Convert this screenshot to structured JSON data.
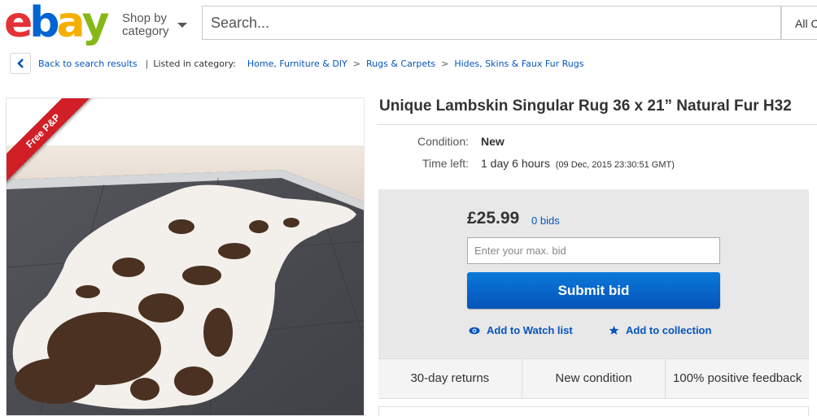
{
  "header": {
    "logo_letters": [
      "e",
      "b",
      "a",
      "y"
    ],
    "shop_by_line1": "Shop by",
    "shop_by_line2": "category",
    "search_placeholder": "Search...",
    "category_select": "All Categories",
    "colors": {
      "logo_e": "#e53238",
      "logo_b": "#0064d2",
      "logo_a": "#f5af02",
      "logo_y": "#86b817"
    }
  },
  "breadcrumb": {
    "back_label": "Back to search results",
    "listed_label": "Listed in category:",
    "items": [
      "Home, Furniture & DIY",
      "Rugs & Carpets",
      "Hides, Skins & Faux Fur Rugs"
    ],
    "back_icon": "chevron-left-icon"
  },
  "listing": {
    "ribbon": "Free P&P",
    "title": "Unique Lambskin Singular Rug 36 x 21” Natural Fur H32",
    "condition_label": "Condition:",
    "condition_value": "New",
    "time_left_label": "Time left:",
    "time_left_value": "1 day 6 hours",
    "time_left_date": "(09 Dec, 2015   23:30:51 GMT)"
  },
  "bid": {
    "price": "£25.99",
    "bids": "0 bids",
    "input_placeholder": "Enter your max. bid",
    "submit_label": "Submit bid",
    "watch_label": "Add to Watch list",
    "collection_label": "Add to collection",
    "accent_color": "#0654ba"
  },
  "trust": {
    "returns": "30-day returns",
    "condition": "New condition",
    "feedback": "100% positive feedback"
  }
}
